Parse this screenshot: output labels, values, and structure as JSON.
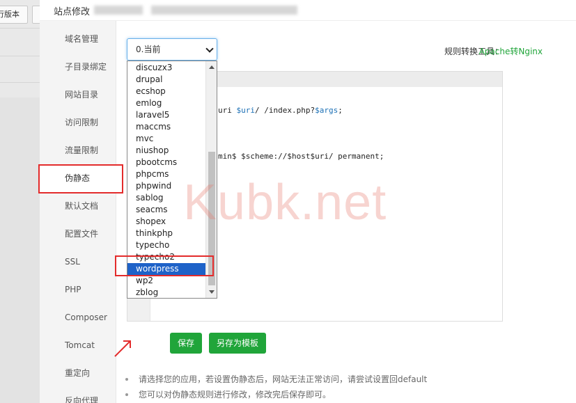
{
  "background": {
    "button_left": "行版本"
  },
  "modal": {
    "title": "站点修改"
  },
  "sidebar": {
    "items": [
      {
        "label": "域名管理"
      },
      {
        "label": "子目录绑定"
      },
      {
        "label": "网站目录"
      },
      {
        "label": "访问限制"
      },
      {
        "label": "流量限制"
      },
      {
        "label": "伪静态"
      },
      {
        "label": "默认文档"
      },
      {
        "label": "配置文件"
      },
      {
        "label": "SSL"
      },
      {
        "label": "PHP"
      },
      {
        "label": "Composer"
      },
      {
        "label": "Tomcat"
      },
      {
        "label": "重定向"
      },
      {
        "label": "反向代理"
      }
    ],
    "active": "伪静态"
  },
  "rewrite": {
    "select_value": "0.当前",
    "tool_label": "规则转换工具：",
    "tool_link": "Apache转Nginx",
    "code_line1_pre": "uri ",
    "code_line1_var1": "$uri",
    "code_line1_mid": "/ /index.php?",
    "code_line1_var2": "$args",
    "code_line1_end": ";",
    "code_line2_pre": "min$ $scheme://$host$uri/ permanent;",
    "dropdown_options": [
      "discuzx3",
      "drupal",
      "ecshop",
      "emlog",
      "laravel5",
      "maccms",
      "mvc",
      "niushop",
      "pbootcms",
      "phpcms",
      "phpwind",
      "sablog",
      "seacms",
      "shopex",
      "thinkphp",
      "typecho",
      "typecho2",
      "wordpress",
      "wp2",
      "zblog"
    ],
    "dropdown_selected": "wordpress"
  },
  "buttons": {
    "save": "保存",
    "save_template": "另存为模板"
  },
  "tips": [
    "请选择您的应用，若设置伪静态后，网站无法正常访问，请尝试设置回default",
    "您可以对伪静态规则进行修改，修改完后保存即可。"
  ],
  "watermark": "Kubk.net",
  "colors": {
    "accent_green": "#20a53a",
    "highlight_red": "#e32b2b",
    "selection_blue": "#1e62c8"
  }
}
